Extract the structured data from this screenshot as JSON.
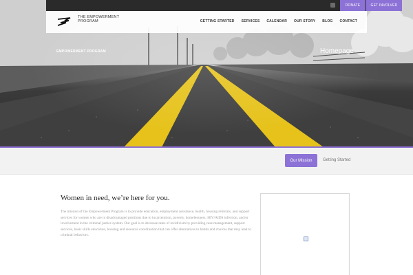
{
  "topbar": {
    "facebook_icon": "facebook-icon",
    "donate_label": "DONATE",
    "get_involved_label": "GET INVOLVED",
    "accent_color": "#8c72d6"
  },
  "navbar": {
    "logo_text": "THE EMPOWERMENT PROGRAM",
    "items": [
      {
        "label": "GETTING STARTED"
      },
      {
        "label": "SERVICES"
      },
      {
        "label": "CALENDAR"
      },
      {
        "label": "OUR STORY"
      },
      {
        "label": "BLOG"
      },
      {
        "label": "CONTACT"
      }
    ]
  },
  "hero": {
    "left_label": "EMPOWERMENT PROGRAM",
    "right_label": "Homepage"
  },
  "subnav": {
    "active_label": "Our Mission",
    "link_label": "Getting Started"
  },
  "main": {
    "title": "Women in need, we’re here for you.",
    "body": "The mission of the Empowerment Program is to provide education, employment assistance, health, housing referrals, and support services for women who are in disadvantaged positions due to incarceration, poverty, homelessness, HIV/AIDS infection, and/or involvement in the criminal justice system. Our goal is to decrease rates of recidivism by providing case management, support services, basic skills education, housing and resource coordination that can offer alternatives to habits and choices that may lead to criminal behaviors."
  },
  "embed": {
    "icon": "broken-image-icon"
  }
}
